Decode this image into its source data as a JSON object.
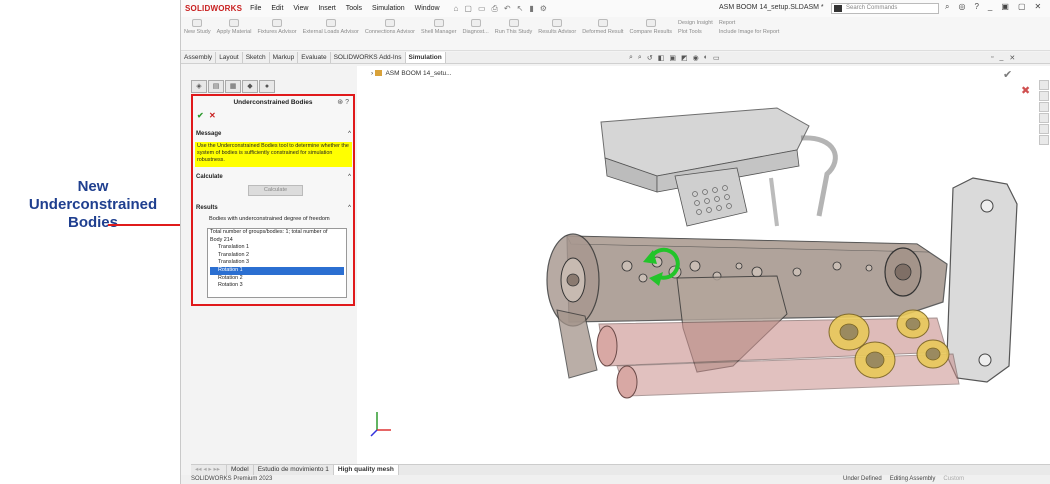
{
  "callout": {
    "line1": "New",
    "line2": "Underconstrained",
    "line3": "Bodies"
  },
  "titlebar": {
    "logo": "SOLIDWORKS",
    "menus": [
      "File",
      "Edit",
      "View",
      "Insert",
      "Tools",
      "Simulation",
      "Window"
    ],
    "document_title": "ASM BOOM 14_setup.SLDASM *",
    "search_placeholder": "Search Commands"
  },
  "ribbon": {
    "buttons": [
      "New Study",
      "Apply Material",
      "Fixtures Advisor",
      "External Loads Advisor",
      "Connections Advisor",
      "Shell Manager",
      "Diagnost...",
      "Run This Study",
      "Results Advisor",
      "Deformed Result",
      "Compare Results",
      "Design Insight",
      "Plot Tools",
      "Report",
      "Include Image for Report"
    ]
  },
  "command_tabs": [
    "Assembly",
    "Layout",
    "Sketch",
    "Markup",
    "Evaluate",
    "SOLIDWORKS Add-Ins",
    "Simulation"
  ],
  "active_tab": "Simulation",
  "tree": {
    "root": "ASM BOOM 14_setu..."
  },
  "panel": {
    "title": "Underconstrained Bodies",
    "message_heading": "Message",
    "message_text": "Use the Underconstrained Bodies tool to determine whether the system of bodies is sufficiently constrained for simulation robustness.",
    "calculate_heading": "Calculate",
    "calculate_button": "Calculate",
    "results_heading": "Results",
    "results_label": "Bodies with underconstrained degree of freedom",
    "results_list": [
      "Total number of groups/bodies: 1; total number of",
      "Body 214",
      "Translation 1",
      "Translation 2",
      "Translation 3",
      "Rotation 1",
      "Rotation 2",
      "Rotation 3"
    ],
    "selected_item": "Rotation 1"
  },
  "bottom_tabs": [
    "Model",
    "Estudio de movimiento 1",
    "High quality mesh"
  ],
  "status": {
    "product": "SOLIDWORKS Premium 2023",
    "state": "Under Defined",
    "mode": "Editing Assembly",
    "units": "Custom"
  },
  "colors": {
    "callout_text": "#1f3f8f",
    "highlight_border": "#e0191b",
    "message_bg": "#ffff00",
    "selection": "#2b6fd1"
  }
}
